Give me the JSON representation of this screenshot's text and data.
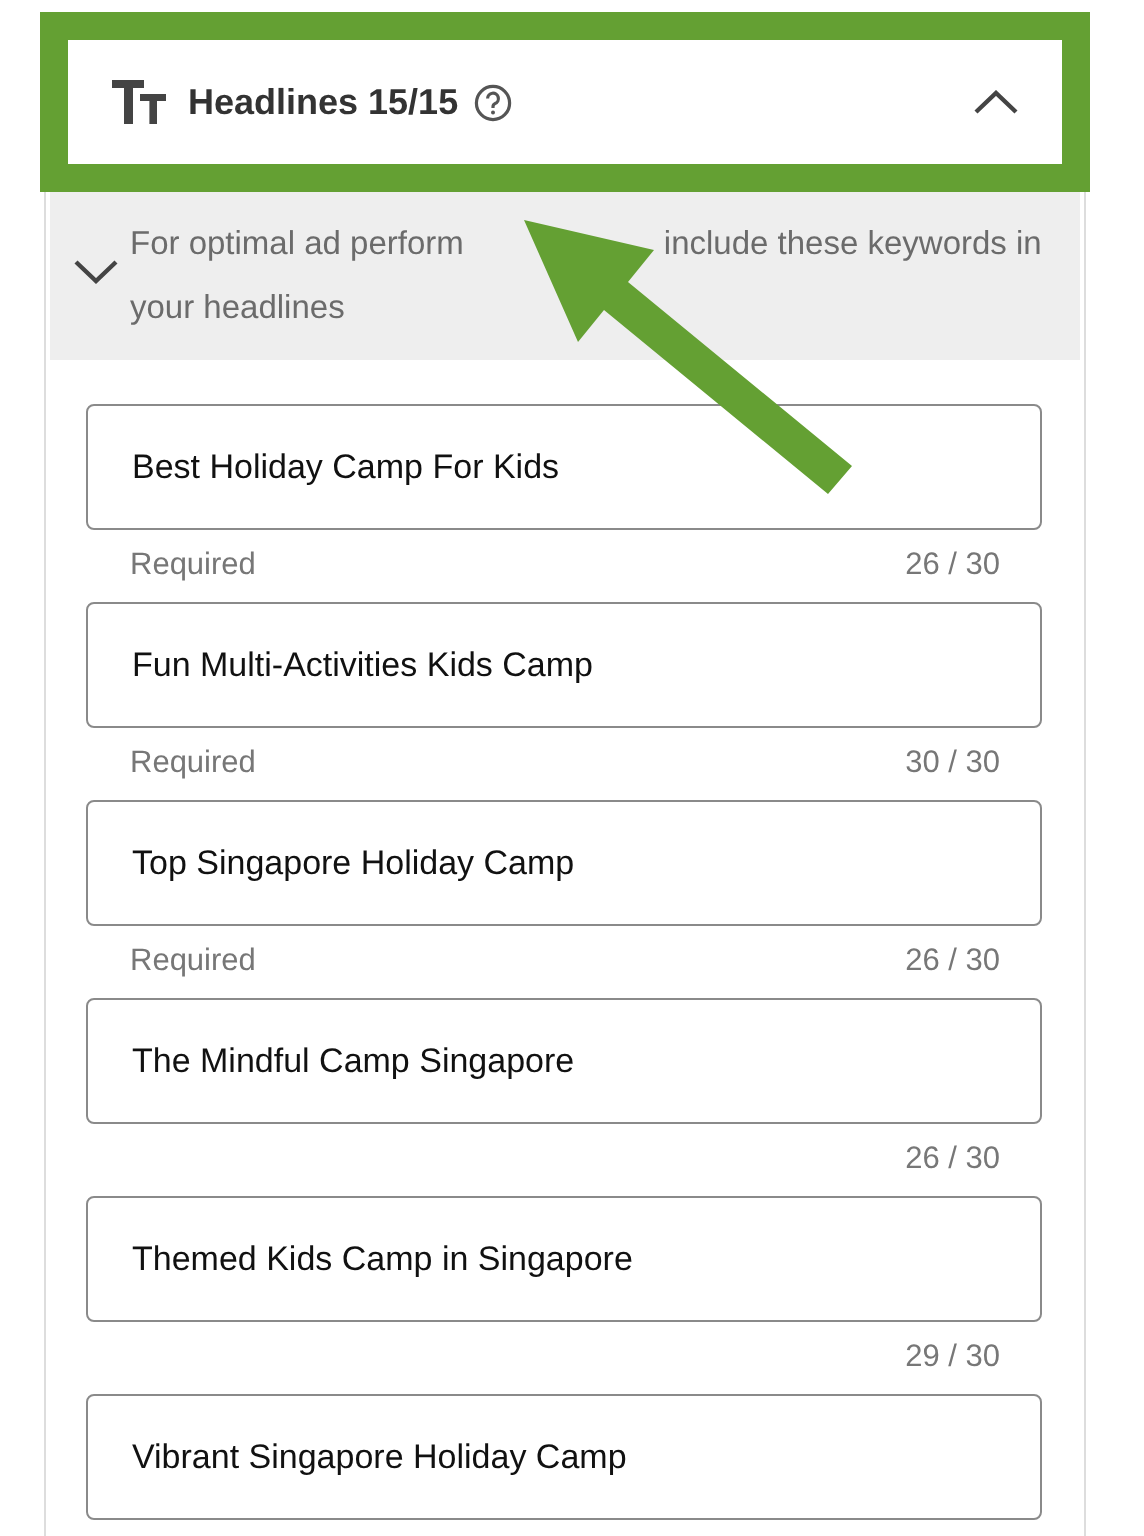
{
  "section": {
    "title": "Headlines 15/15",
    "expanded": true
  },
  "hint": {
    "expanded": false,
    "parts": [
      "For optimal ad perform",
      "include these keywords in",
      "your headlines"
    ]
  },
  "headlines": [
    {
      "value": "Best Holiday Camp For Kids",
      "helper": "Required",
      "counter": "26 / 30"
    },
    {
      "value": "Fun Multi-Activities Kids Camp",
      "helper": "Required",
      "counter": "30 / 30"
    },
    {
      "value": "Top Singapore Holiday Camp",
      "helper": "Required",
      "counter": "26 / 30"
    },
    {
      "value": "The Mindful Camp Singapore",
      "counter": "26 / 30"
    },
    {
      "value": "Themed Kids Camp in Singapore",
      "counter": "29 / 30"
    },
    {
      "value": "Vibrant Singapore Holiday Camp"
    }
  ]
}
